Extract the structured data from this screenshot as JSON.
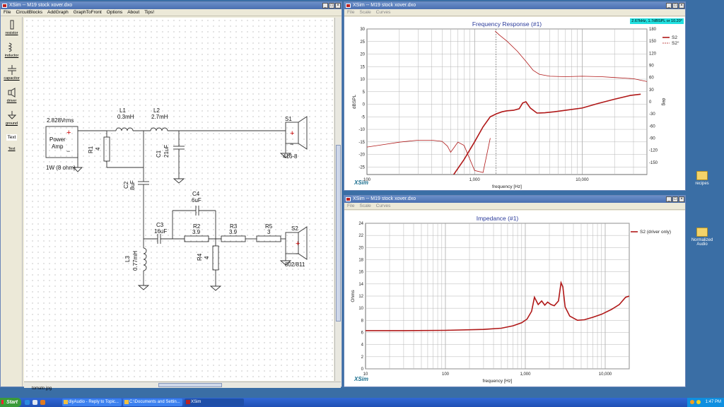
{
  "main_window": {
    "title": "XSim -- M19 stock xover.dxo",
    "menu": [
      "File",
      "CircuitBlocks",
      "AddGraph",
      "GraphToFront",
      "Options",
      "About",
      "Tips!"
    ],
    "status": "tomato.jpg"
  },
  "toolbox": [
    {
      "label": "resistor",
      "icon": "resistor-icon"
    },
    {
      "label": "inductor",
      "icon": "inductor-icon"
    },
    {
      "label": "capacitor",
      "icon": "capacitor-icon"
    },
    {
      "label": "driver",
      "icon": "speaker-icon"
    },
    {
      "label": "ground",
      "icon": "ground-icon"
    },
    {
      "label": "Text",
      "icon": "text-icon"
    },
    {
      "label": "Text",
      "icon": "text-tool"
    }
  ],
  "schematic": {
    "source_voltage": "2.828Vrms",
    "amp_label_1": "Power",
    "amp_label_2": "Amp",
    "amp_impedance": "1W (8 ohm)",
    "plus": "+",
    "minus": "−",
    "L1": {
      "name": "L1",
      "value": "0.3mH"
    },
    "L2": {
      "name": "L2",
      "value": "2.7mH"
    },
    "L3": {
      "name": "L3",
      "value": "0.77mH"
    },
    "R1": {
      "name": "R1",
      "value": "4"
    },
    "R2": {
      "name": "R2",
      "value": "3.9"
    },
    "R3": {
      "name": "R3",
      "value": "3.9"
    },
    "R4": {
      "name": "R4",
      "value": "4"
    },
    "R5": {
      "name": "R5",
      "value": "3"
    },
    "C1": {
      "name": "C1",
      "value": "21uF"
    },
    "C2": {
      "name": "C2",
      "value": "8uF"
    },
    "C3": {
      "name": "C3",
      "value": "16uF"
    },
    "C4": {
      "name": "C4",
      "value": "6uF"
    },
    "S1": {
      "name": "S1",
      "model": "416-8"
    },
    "S2": {
      "name": "S2",
      "model": "802/811"
    }
  },
  "freq_window": {
    "title": "XSim -- M19 stock xover.dxo",
    "menu": [
      "File",
      "Scale",
      "Curves"
    ],
    "cursor_readout": "2.67kHz, 1.7dBSPL or 10.20°",
    "chart_title": "Frequency Response (#1)",
    "logo": "XSim",
    "legend": [
      "S2",
      "S2°"
    ]
  },
  "imp_window": {
    "title": "XSim -- M19 stock xover.dxo",
    "menu": [
      "File",
      "Scale",
      "Curves"
    ],
    "chart_title": "Impedance (#1)",
    "logo": "XSim",
    "legend": [
      "S2 (driver only)"
    ]
  },
  "chart_data": [
    {
      "type": "line",
      "title": "Frequency Response (#1)",
      "xlabel": "frequency [Hz]",
      "ylabel": "dBSPL",
      "y2label": "deg",
      "x_scale": "log",
      "xlim": [
        100,
        40000
      ],
      "ylim": [
        -28,
        30
      ],
      "y2lim": [
        -180,
        180
      ],
      "x_ticks": [
        "100",
        "1,000",
        "10,000"
      ],
      "y_ticks": [
        "30",
        "25",
        "20",
        "15",
        "10",
        "5",
        "0",
        "-5",
        "-10",
        "-15",
        "-20",
        "-25"
      ],
      "y2_ticks": [
        "180",
        "150",
        "120",
        "90",
        "60",
        "30",
        "0",
        "-30",
        "-60",
        "-90",
        "-120",
        "-150"
      ],
      "grid": true,
      "legend_position": "top-right",
      "cursor_x": 1580,
      "series": [
        {
          "name": "S2",
          "axis": "left",
          "color": "#b01818",
          "x": [
            640,
            800,
            1000,
            1200,
            1400,
            1600,
            1800,
            2000,
            2300,
            2600,
            2800,
            3000,
            3300,
            3800,
            4500,
            5500,
            7000,
            10000,
            14000,
            20000,
            28000,
            35000
          ],
          "y": [
            -28,
            -22,
            -15,
            -9,
            -5,
            -3.8,
            -3,
            -2.6,
            -2.4,
            -1.8,
            0.5,
            1.0,
            -1.5,
            -3.5,
            -3.4,
            -3,
            -2.4,
            -1.5,
            0.3,
            2,
            3.5,
            4
          ]
        },
        {
          "name": "S2°",
          "axis": "right",
          "color": "#b01818",
          "dashed": false,
          "x": [
            100,
            150,
            200,
            300,
            400,
            500,
            560,
            600,
            650,
            700,
            800,
            1000,
            1200,
            1400,
            1550,
            1700,
            2000,
            2500,
            3000,
            3500,
            4000,
            5000,
            7000,
            10000,
            15000,
            20000,
            30000,
            40000
          ],
          "y": [
            -112,
            -105,
            -100,
            -95,
            -95,
            -98,
            -110,
            -125,
            -112,
            -100,
            -108,
            -170,
            -175,
            -90,
            175,
            165,
            150,
            125,
            100,
            78,
            68,
            63,
            62,
            63,
            62,
            60,
            57,
            50
          ]
        }
      ]
    },
    {
      "type": "line",
      "title": "Impedance (#1)",
      "xlabel": "frequency [Hz]",
      "ylabel": "Ohms",
      "x_scale": "log",
      "xlim": [
        10,
        20000
      ],
      "ylim": [
        0,
        24
      ],
      "x_ticks": [
        "10",
        "100",
        "1,000",
        "10,000"
      ],
      "y_ticks": [
        "24",
        "22",
        "20",
        "18",
        "16",
        "14",
        "12",
        "10",
        "8",
        "6",
        "4",
        "2",
        "0"
      ],
      "grid": true,
      "legend_position": "top-right",
      "series": [
        {
          "name": "S2 (driver only)",
          "color": "#b01818",
          "x": [
            10,
            30,
            100,
            300,
            500,
            700,
            900,
            1050,
            1200,
            1300,
            1450,
            1600,
            1750,
            1900,
            2100,
            2300,
            2600,
            2800,
            2950,
            3150,
            3600,
            4500,
            5500,
            7000,
            9000,
            12000,
            15000,
            18000,
            20000
          ],
          "y": [
            6.3,
            6.3,
            6.35,
            6.5,
            6.7,
            7.1,
            7.6,
            8.2,
            9.5,
            11.8,
            10.6,
            11.2,
            10.5,
            11.0,
            10.6,
            10.4,
            11.2,
            14.2,
            13.5,
            10.2,
            8.7,
            8.0,
            8.1,
            8.5,
            9.0,
            9.8,
            10.6,
            11.8,
            12.0
          ]
        }
      ]
    }
  ],
  "desktop": {
    "icons": [
      {
        "label": "recipes"
      },
      {
        "label": "Normalized Audio"
      }
    ]
  },
  "taskbar": {
    "start": "Start",
    "tasks": [
      {
        "label": "diyAudio - Reply to Topic..."
      },
      {
        "label": "C:\\Documents and Settin..."
      },
      {
        "label": "XSim"
      }
    ],
    "clock": "1:47 PM"
  }
}
